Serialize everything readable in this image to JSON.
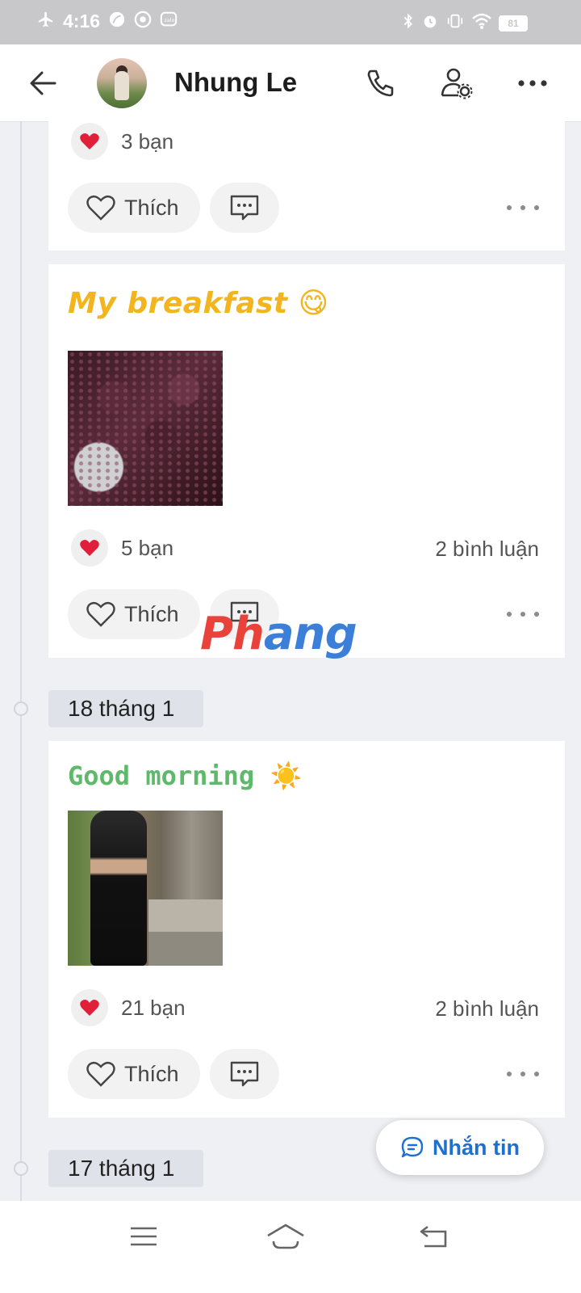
{
  "status_bar": {
    "time": "4:16",
    "battery": "81"
  },
  "header": {
    "title": "Nhung Le"
  },
  "posts": [
    {
      "reactions": "3 bạn",
      "like_label": "Thích"
    },
    {
      "text": "My breakfast 😋",
      "reactions": "5 bạn",
      "comments": "2 bình luận",
      "like_label": "Thích"
    },
    {
      "text": "Good morning ☀️",
      "reactions": "21 bạn",
      "comments": "2 bình luận",
      "like_label": "Thích"
    }
  ],
  "dates": {
    "first": "18 tháng 1",
    "second": "17 tháng 1"
  },
  "watermark": {
    "part1": "Ph",
    "part2": "ang"
  },
  "fab": {
    "label": "Nhắn tin"
  },
  "colors": {
    "accent": "#1f6fd1",
    "heart": "#e0203a",
    "post1_text": "#f3b51e",
    "post2_text": "#5fb96a"
  }
}
